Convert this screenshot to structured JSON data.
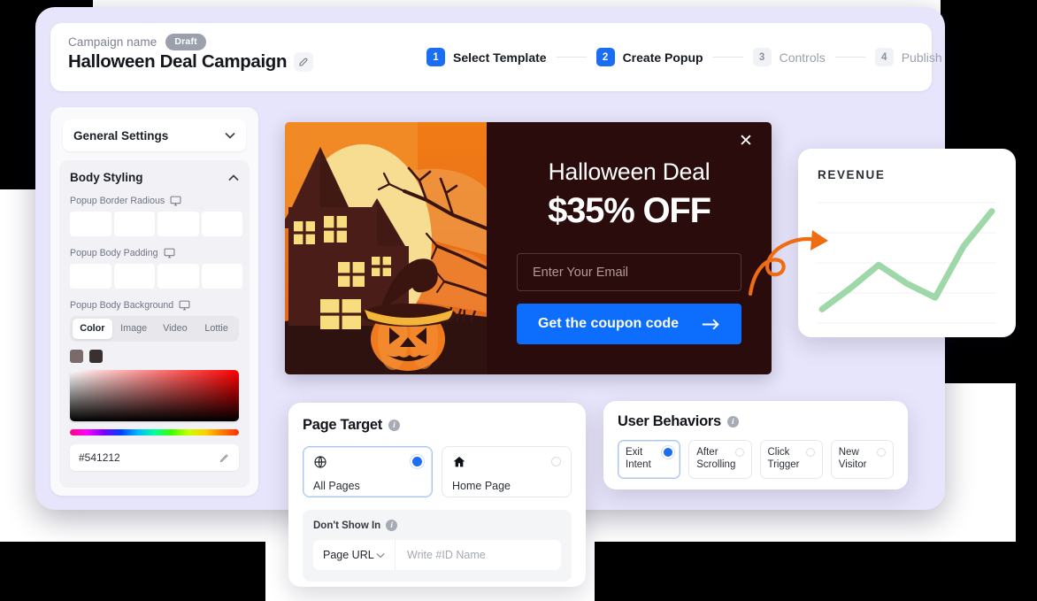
{
  "header": {
    "campaign_label": "Campaign name",
    "badge": "Draft",
    "title": "Halloween Deal Campaign",
    "edit_icon": "pencil-icon",
    "steps": [
      {
        "num": "1",
        "label": "Select Template",
        "state": "active"
      },
      {
        "num": "2",
        "label": "Create Popup",
        "state": "active"
      },
      {
        "num": "3",
        "label": "Controls",
        "state": "idle"
      },
      {
        "num": "4",
        "label": "Publish",
        "state": "idle"
      }
    ]
  },
  "sidebar": {
    "general_settings": "General Settings",
    "general_settings_icon": "chevron-down-icon",
    "body_styling": "Body Styling",
    "body_styling_icon": "chevron-up-icon",
    "border_radius_label": "Popup Border Radious",
    "border_radius_icon": "desktop-icon",
    "border_radius_values": [
      "",
      "",
      "",
      ""
    ],
    "body_padding_label": "Popup Body Padding",
    "body_padding_icon": "desktop-icon",
    "body_padding_values": [
      "",
      "",
      "",
      ""
    ],
    "body_background_label": "Popup Body Background",
    "body_background_icon": "desktop-icon",
    "bg_tabs": [
      "Color",
      "Image",
      "Video",
      "Lottie"
    ],
    "bg_tab_active": "Color",
    "swatches": [
      "#7a6a6a",
      "#3b3030"
    ],
    "hex_value": "#541212",
    "hex_icon": "eyedropper-icon"
  },
  "popup": {
    "close_icon": "close-icon",
    "heading": "Halloween Deal",
    "subheading": "$35% OFF",
    "email_placeholder": "Enter Your Email",
    "cta_label": "Get the coupon code",
    "cta_icon": "arrow-right-icon",
    "cta_color": "#0d6efd",
    "body_color": "#2a0c0c"
  },
  "revenue": {
    "title": "REVENUE"
  },
  "chart_data": {
    "type": "line",
    "title": "REVENUE",
    "xlabel": "",
    "ylabel": "",
    "grid": true,
    "legend": "none",
    "series": [
      {
        "name": "Revenue",
        "color": "#9ed7a8",
        "values": [
          8,
          26,
          46,
          30,
          18,
          62,
          92
        ]
      }
    ],
    "x": [
      0,
      1,
      2,
      3,
      4,
      5,
      6
    ],
    "ylim": [
      0,
      100
    ]
  },
  "page_target": {
    "title": "Page Target",
    "info_icon": "info-icon",
    "options": [
      {
        "label": "All Pages",
        "icon": "globe-icon",
        "selected": true
      },
      {
        "label": "Home Page",
        "icon": "home-icon",
        "selected": false
      }
    ],
    "dont_show_label": "Don't Show In",
    "dont_show_icon": "info-icon",
    "select_value": "Page URL",
    "select_icon": "chevron-down-icon",
    "input_placeholder": "Write #ID Name",
    "input_value": ""
  },
  "user_behaviors": {
    "title": "User Behaviors",
    "info_icon": "info-icon",
    "options": [
      {
        "line1": "Exit",
        "line2": "Intent",
        "selected": true
      },
      {
        "line1": "After",
        "line2": "Scrolling",
        "selected": false
      },
      {
        "line1": "Click",
        "line2": "Trigger",
        "selected": false
      },
      {
        "line1": "New",
        "line2": "Visitor",
        "selected": false
      }
    ]
  },
  "annotation": {
    "arrow_icon": "curved-arrow-icon",
    "arrow_color": "#ef6c12"
  }
}
